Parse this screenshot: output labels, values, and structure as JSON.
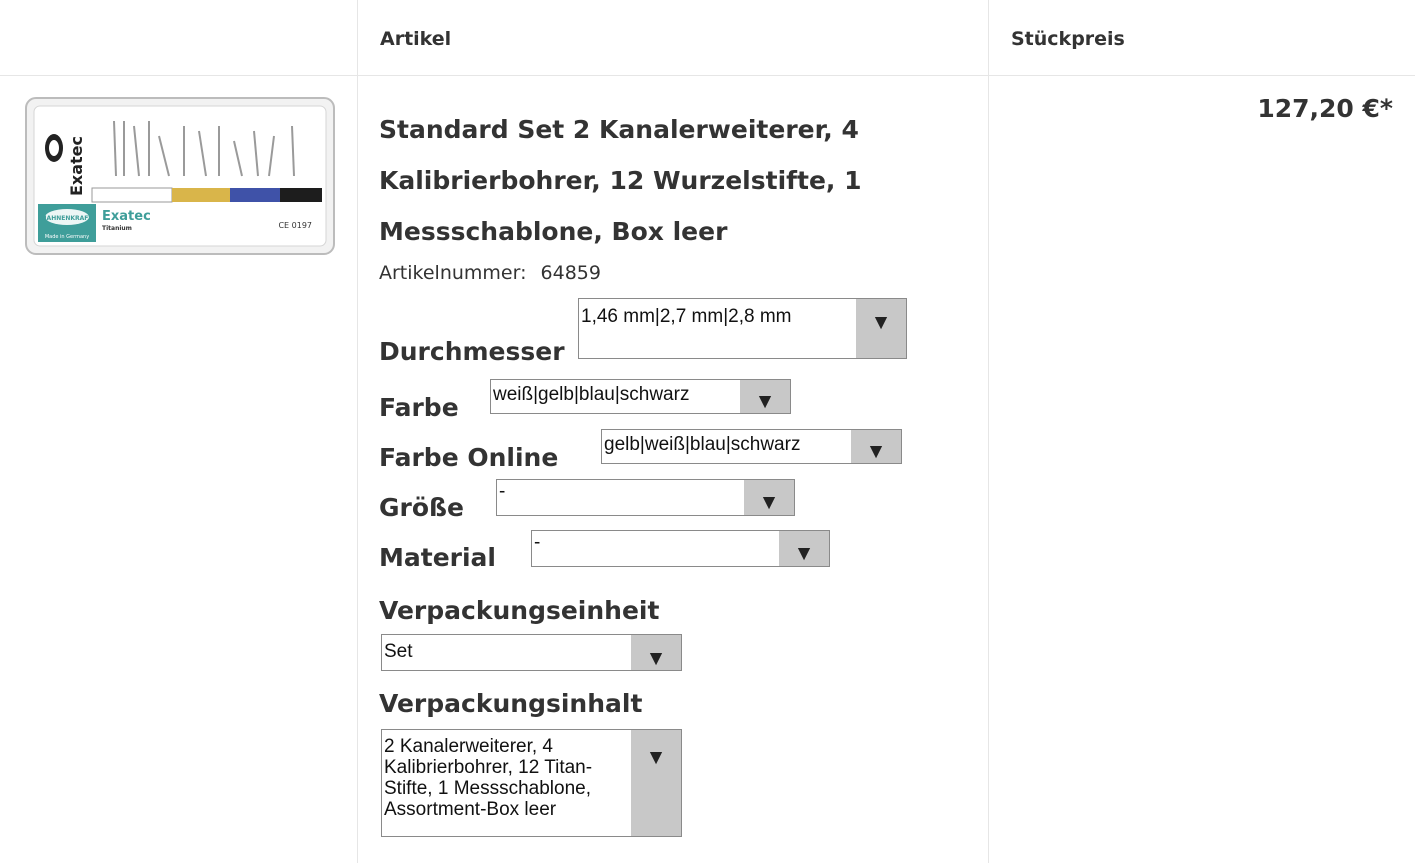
{
  "header": {
    "col_article": "Artikel",
    "col_unit_price": "Stückpreis"
  },
  "product": {
    "title": "Standard Set 2 Kanalerweiterer, 4 Kalibrierbohrer, 12 Wurzelstifte, 1 Messschablone, Box leer",
    "article_number_label": "Artikelnummer:",
    "article_number": "64859",
    "price": "127,20 €*",
    "image_text": {
      "brand": "Exatec",
      "company": "HAHNENKRAFT",
      "material": "Titanium",
      "made_in": "Made in Germany",
      "ce": "CE 0197"
    }
  },
  "options": {
    "durchmesser": {
      "label": "Durchmesser",
      "value": "1,46 mm|2,7 mm|2,8 mm"
    },
    "farbe": {
      "label": "Farbe",
      "value": "weiß|gelb|blau|schwarz"
    },
    "farbe_online": {
      "label": "Farbe Online",
      "value": "gelb|weiß|blau|schwarz"
    },
    "groesse": {
      "label": "Größe",
      "value": "-"
    },
    "material": {
      "label": "Material",
      "value": "-"
    },
    "verpackungseinheit": {
      "label": "Verpackungseinheit",
      "value": "Set"
    },
    "verpackungsinhalt": {
      "label": "Verpackungsinhalt",
      "value": "2 Kanalerweiterer, 4 Kalibrierbohrer, 12 Titan-Stifte, 1 Messschablone, Assortment-Box leer"
    }
  },
  "icons": {
    "dropdown_arrow": "▼"
  },
  "colors": {
    "image_teal": "#3f9e9a",
    "image_yellow": "#d9b54a",
    "image_blue": "#3f52a8",
    "image_black": "#1d1d1d"
  }
}
